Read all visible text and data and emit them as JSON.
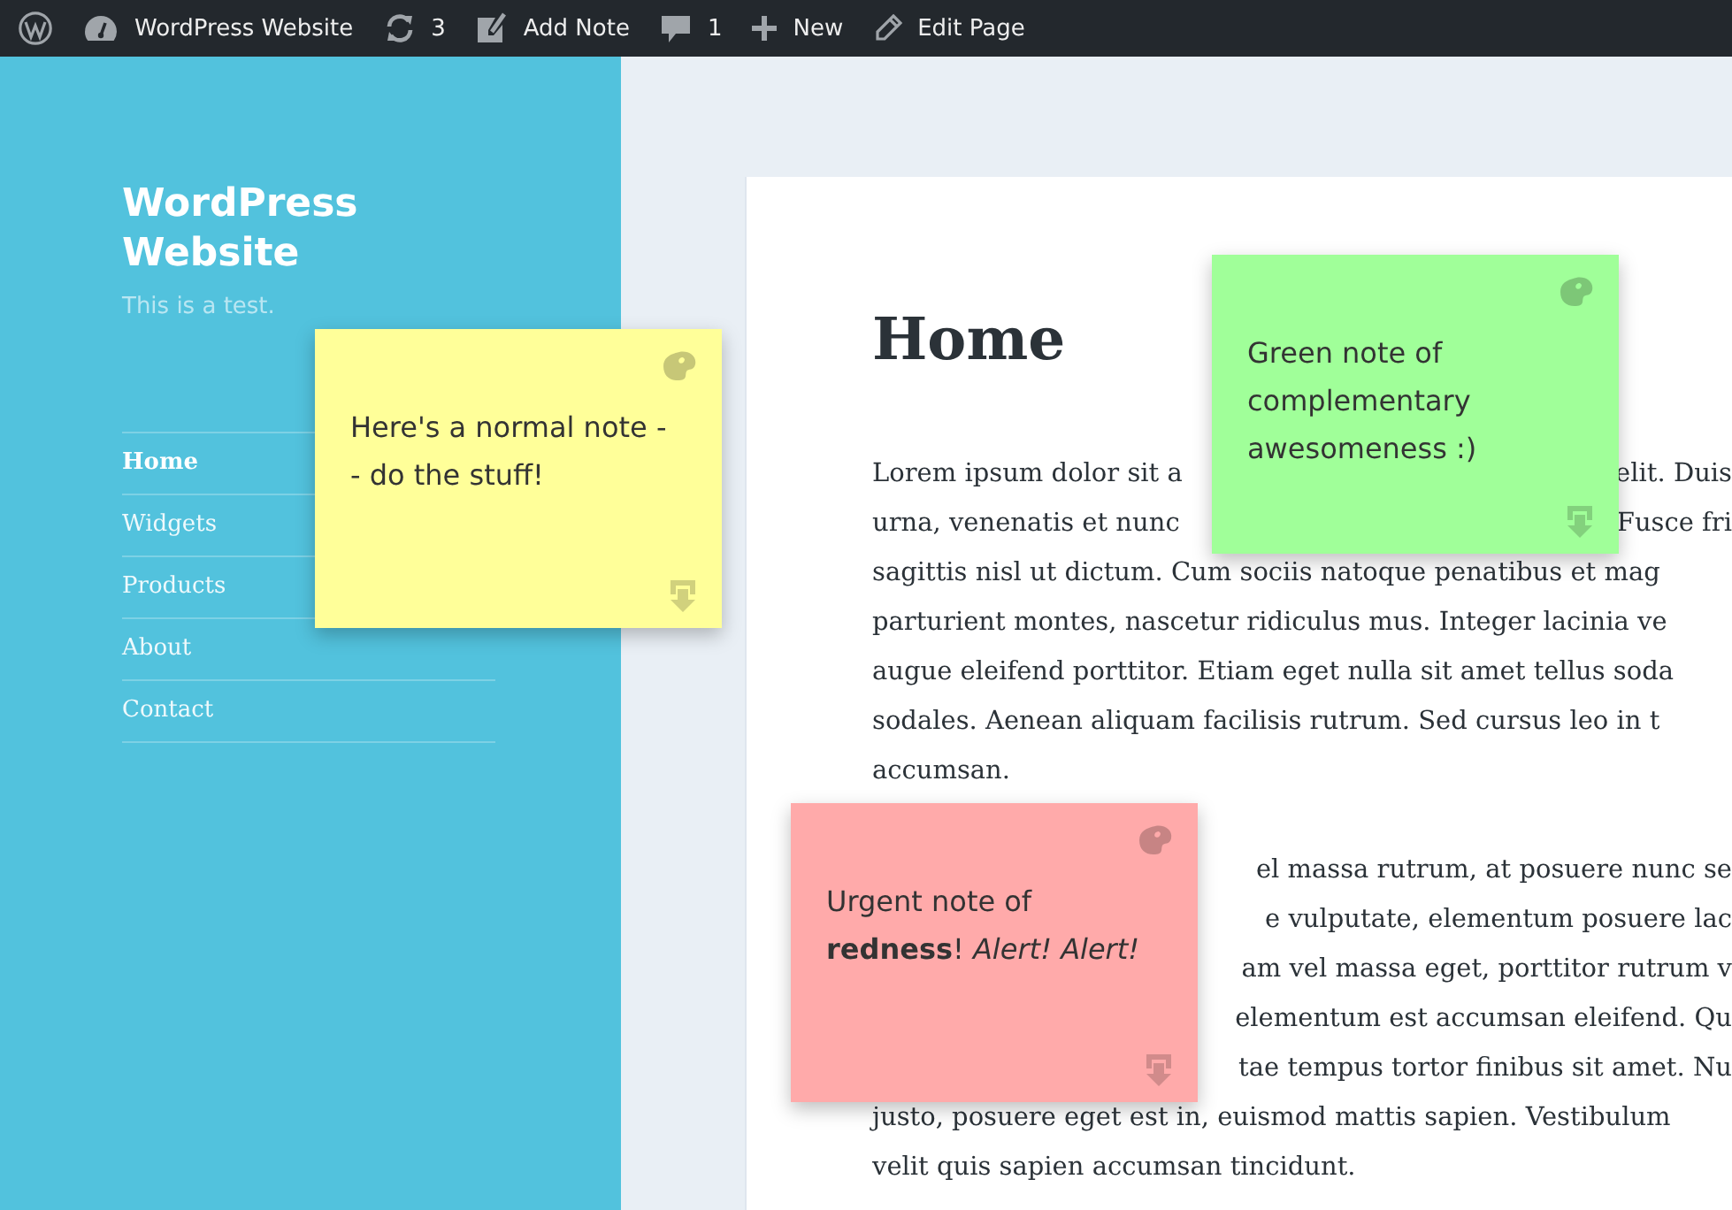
{
  "admin_bar": {
    "items": [
      {
        "kind": "logo"
      },
      {
        "kind": "site",
        "label": "WordPress Website"
      },
      {
        "kind": "updates",
        "label": "3"
      },
      {
        "kind": "add-note",
        "label": "Add Note"
      },
      {
        "kind": "comments",
        "label": "1"
      },
      {
        "kind": "new",
        "label": "New"
      },
      {
        "kind": "edit",
        "label": "Edit Page"
      }
    ]
  },
  "sidebar": {
    "site_title": "WordPress Website",
    "tagline": "This is a test.",
    "menu": [
      {
        "label": "Home",
        "selected": true
      },
      {
        "label": "Widgets",
        "selected": false
      },
      {
        "label": "Products",
        "selected": false
      },
      {
        "label": "About",
        "selected": false
      },
      {
        "label": "Contact",
        "selected": false
      }
    ]
  },
  "article": {
    "title": "Home",
    "paragraphs": [
      [
        {
          "left": "Lorem ipsum dolor sit a",
          "right": "elit. Duis"
        },
        {
          "left": "urna, venenatis et nunc",
          "right": "Fusce fri"
        },
        {
          "left": "sagittis nisl ut dictum. Cum sociis natoque penatibus et mag"
        },
        {
          "left": "parturient montes, nascetur ridiculus mus. Integer lacinia ve"
        },
        {
          "left": "augue eleifend porttitor. Etiam eget nulla sit amet tellus soda"
        },
        {
          "left": "sodales. Aenean aliquam facilisis rutrum. Sed cursus leo in t"
        },
        {
          "left": "accumsan."
        }
      ],
      [
        {
          "right": "el massa rutrum, at posuere nunc se"
        },
        {
          "right": "e vulputate, elementum posuere lac"
        },
        {
          "right": "am vel massa eget, porttitor rutrum v"
        },
        {
          "right": "elementum est accumsan eleifend. Qu"
        },
        {
          "right": "tae tempus tortor finibus sit amet. Nu"
        },
        {
          "left": "justo, posuere eget est in, euismod mattis sapien. Vestibulum"
        },
        {
          "left": "velit quis sapien accumsan tincidunt."
        }
      ]
    ]
  },
  "notes": [
    {
      "color": "#ffff99",
      "lines": [
        "Here's a normal note -",
        "- do the stuff!"
      ]
    },
    {
      "color": "#a0ff99",
      "lines": [
        "Green note of",
        "complementary",
        "awesomeness :)"
      ]
    },
    {
      "color": "#ffaaaa",
      "lines": [
        "Urgent note of",
        "**redness**! *Alert! Alert!*"
      ]
    }
  ]
}
